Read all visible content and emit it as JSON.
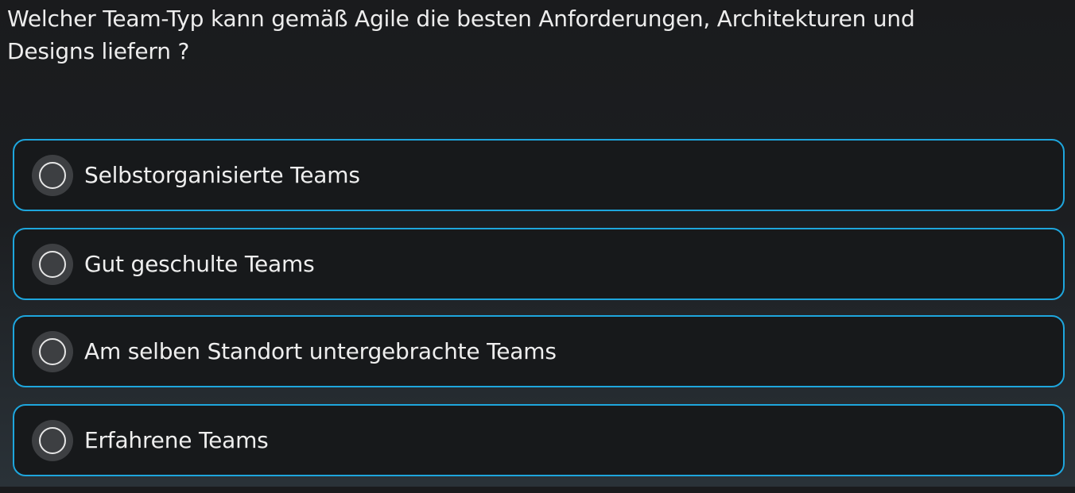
{
  "question": {
    "text": "Welcher Team-Typ kann gemäß Agile die besten Anforderungen, Architekturen und Designs liefern ?"
  },
  "options": [
    {
      "label": "Selbstorganisierte Teams",
      "selected": false
    },
    {
      "label": "Gut geschulte Teams",
      "selected": false
    },
    {
      "label": "Am selben Standort untergebrachte Teams",
      "selected": false
    },
    {
      "label": "Erfahrene Teams",
      "selected": false
    }
  ],
  "colors": {
    "accent_border": "#1ea6dd",
    "option_background": "#17191b",
    "radio_ring": "#3d3f42",
    "text": "#eeeeee"
  }
}
